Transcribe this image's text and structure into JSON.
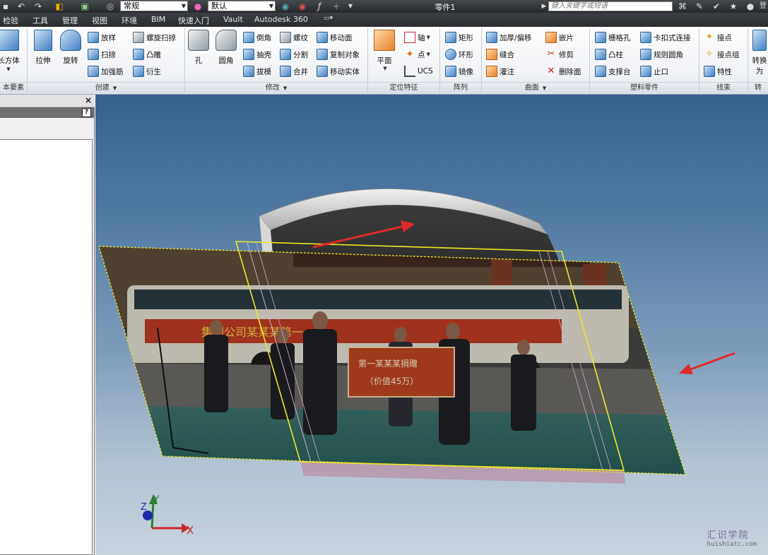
{
  "titlebar": {
    "style_combo": "常规",
    "material_combo": "默认",
    "document_title": "零件1",
    "search_placeholder": "键入关键字或短语",
    "right_cut_label": "登"
  },
  "menu": {
    "tabs": [
      "检验",
      "工具",
      "管理",
      "视图",
      "环境",
      "BIM",
      "快速入门",
      "Vault",
      "Autodesk 360"
    ]
  },
  "ribbon": {
    "panels": {
      "primitives": "本要素",
      "create": "创建",
      "modify": "修改",
      "work_features": "定位特征",
      "pattern": "阵列",
      "surface": "曲面",
      "plastic_part": "塑料零件",
      "harness": "线束",
      "convert": "转"
    },
    "primitives": {
      "box": "长方体"
    },
    "create": {
      "extrude": "拉伸",
      "revolve": "旋转",
      "loft": "放样",
      "sweep": "扫掠",
      "rib": "加强筋",
      "coil": "螺旋扫掠",
      "emboss": "凸雕",
      "derive": "衍生"
    },
    "modify": {
      "hole": "孔",
      "fillet": "圆角",
      "chamfer": "倒角",
      "shell": "抽壳",
      "draft": "拔模",
      "thread": "螺纹",
      "split": "分割",
      "combine": "合并",
      "move_face": "移动面",
      "copy_object": "复制对象",
      "move_bodies": "移动实体"
    },
    "work_features": {
      "plane": "平面",
      "axis": "轴",
      "point": "点",
      "ucs": "UCS"
    },
    "pattern": {
      "rectangular": "矩形",
      "circular": "环形",
      "mirror": "镜像"
    },
    "surface": {
      "thicken": "加厚/偏移",
      "stitch": "缝合",
      "patch": "灌注",
      "sculpt": "嵌片",
      "trim": "修剪",
      "delete_face": "删除面"
    },
    "plastic": {
      "grill": "栅格孔",
      "boss": "凸柱",
      "rest": "支撑台",
      "snap_fit": "卡扣式连接",
      "rule_fillet": "规则圆角",
      "lip": "止口"
    },
    "harness": {
      "splice": "接点",
      "splice_group": "接点组",
      "properties": "特性"
    },
    "convert": {
      "convert_label": "转换为"
    }
  },
  "viewport": {
    "axis_labels": {
      "x": "X",
      "y": "Y",
      "z": "Z"
    },
    "watermark_cn": "汇识学院",
    "watermark_en": "huishiatc.com",
    "photo_banner_text": "集团公司某某某第一",
    "photo_sign_line1": "第一某某某捐赠",
    "photo_sign_line2": "（价值45万）"
  },
  "colors": {
    "titlebar_bg": "#2f3134",
    "ribbon_bg": "#f1f3f6",
    "viewport_top": "#37608d",
    "viewport_bottom": "#c8d3de",
    "selection_yellow": "#f0e62a",
    "arrow_red": "#e02a2a"
  }
}
